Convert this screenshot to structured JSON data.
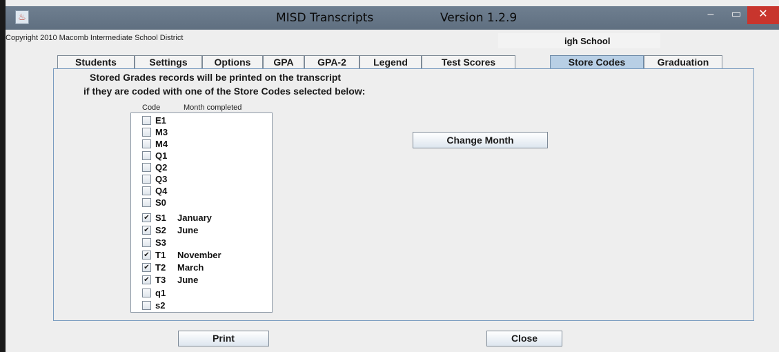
{
  "window": {
    "title": "MISD Transcripts",
    "version": "Version 1.2.9",
    "controls": {
      "minimize": "–",
      "maximize": "▭",
      "close": "✕"
    }
  },
  "header": {
    "copyright": "Copyright 2010 Macomb Intermediate School District",
    "school": "igh School"
  },
  "tabs": [
    {
      "label": "Students"
    },
    {
      "label": "Settings"
    },
    {
      "label": "Options"
    },
    {
      "label": "GPA"
    },
    {
      "label": "GPA-2"
    },
    {
      "label": "Legend"
    },
    {
      "label": "Test Scores"
    },
    {
      "label": "Store Codes",
      "active": true
    },
    {
      "label": "Graduation"
    }
  ],
  "panel": {
    "instruction_line1": "Stored Grades records will be printed on the transcript",
    "instruction_line2": "if they are coded with one of the Store Codes selected below:",
    "column_code": "Code",
    "column_month": "Month completed",
    "change_month_label": "Change Month",
    "store_codes": [
      {
        "code": "E1",
        "checked": false,
        "month": ""
      },
      {
        "code": "M3",
        "checked": false,
        "month": ""
      },
      {
        "code": "M4",
        "checked": false,
        "month": ""
      },
      {
        "code": "Q1",
        "checked": false,
        "month": ""
      },
      {
        "code": "Q2",
        "checked": false,
        "month": ""
      },
      {
        "code": "Q3",
        "checked": false,
        "month": ""
      },
      {
        "code": "Q4",
        "checked": false,
        "month": ""
      },
      {
        "code": "S0",
        "checked": false,
        "month": ""
      },
      {
        "code": "S1",
        "checked": true,
        "month": "January"
      },
      {
        "code": "S2",
        "checked": true,
        "month": "June"
      },
      {
        "code": "S3",
        "checked": false,
        "month": ""
      },
      {
        "code": "T1",
        "checked": true,
        "month": "November"
      },
      {
        "code": "T2",
        "checked": true,
        "month": "March"
      },
      {
        "code": "T3",
        "checked": true,
        "month": "June"
      },
      {
        "code": "q1",
        "checked": false,
        "month": ""
      },
      {
        "code": "s2",
        "checked": false,
        "month": ""
      }
    ]
  },
  "footer": {
    "print_label": "Print",
    "close_label": "Close"
  },
  "icons": {
    "app": "java-app-icon",
    "check": "✔"
  }
}
